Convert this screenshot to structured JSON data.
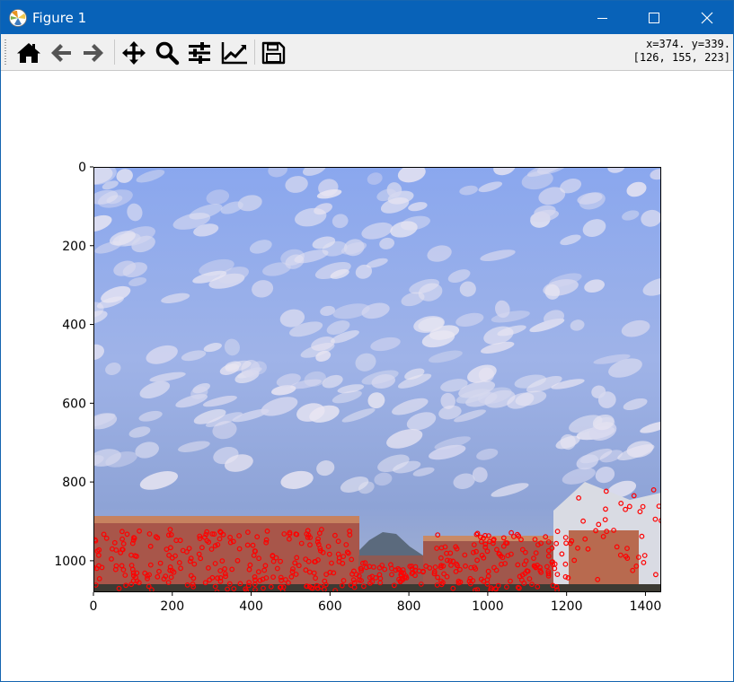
{
  "window": {
    "title": "Figure 1"
  },
  "title_buttons": {
    "minimize": "minimize-icon",
    "maximize": "maximize-icon",
    "close": "close-icon"
  },
  "toolbar": {
    "tools": [
      {
        "name": "home",
        "icon": "home-icon"
      },
      {
        "name": "back",
        "icon": "arrow-left-icon"
      },
      {
        "name": "forward",
        "icon": "arrow-right-icon"
      },
      {
        "name": "pan",
        "icon": "move-icon"
      },
      {
        "name": "zoom",
        "icon": "magnifier-icon"
      },
      {
        "name": "configure-subplots",
        "icon": "sliders-icon"
      },
      {
        "name": "edit-axis",
        "icon": "line-chart-icon"
      },
      {
        "name": "save",
        "icon": "floppy-disk-icon"
      }
    ],
    "coords_line1": "x=374. y=339.",
    "coords_line2": "[126, 155, 223]"
  },
  "chart_data": {
    "type": "image",
    "description_of_content": "photo of cloudy sky over buildings with red feature keypoint circles",
    "x_ticks": [
      "0",
      "200",
      "400",
      "600",
      "800",
      "1000",
      "1200",
      "1400"
    ],
    "y_ticks": [
      "0",
      "200",
      "400",
      "600",
      "800",
      "1000"
    ],
    "xlim": [
      0,
      1440
    ],
    "ylim": [
      1080,
      0
    ],
    "image_size": [
      1440,
      1080
    ],
    "marker_color": "#ff0000"
  },
  "colors": {
    "titlebar": "#0862b8",
    "sky_top": "#7d9cea",
    "sky_bottom": "#8aa5df",
    "marker": "#ff0000"
  }
}
